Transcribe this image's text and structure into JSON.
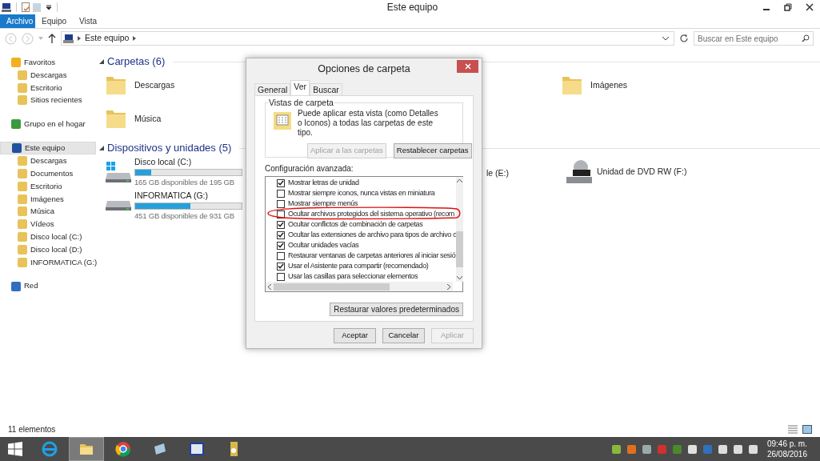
{
  "window": {
    "title": "Este equipo"
  },
  "ribbon_tabs": [
    {
      "label": "Archivo",
      "selected": true
    },
    {
      "label": "Equipo",
      "selected": false
    },
    {
      "label": "Vista",
      "selected": false
    }
  ],
  "address": {
    "path": "Este equipo",
    "search_placeholder": "Buscar en Este equipo"
  },
  "sidebar": [
    {
      "label": "Favoritos",
      "selected": false,
      "children": [
        {
          "label": "Descargas",
          "selected": false
        },
        {
          "label": "Escritorio",
          "selected": false
        },
        {
          "label": "Sitios recientes",
          "selected": false
        }
      ]
    },
    {
      "label": "Grupo en el hogar",
      "selected": false
    },
    {
      "label": "Este equipo",
      "selected": true,
      "children": [
        {
          "label": "Descargas",
          "selected": false
        },
        {
          "label": "Documentos",
          "selected": false
        },
        {
          "label": "Escritorio",
          "selected": false
        },
        {
          "label": "Imágenes",
          "selected": false
        },
        {
          "label": "Música",
          "selected": false
        },
        {
          "label": "Vídeos",
          "selected": false
        },
        {
          "label": "Disco local (C:)",
          "selected": false
        },
        {
          "label": "Disco local (D:)",
          "selected": false
        },
        {
          "label": "INFORMATICA (G:)",
          "selected": false
        }
      ]
    },
    {
      "label": "Red",
      "selected": false
    }
  ],
  "sections": [
    {
      "title": "Carpetas (6)",
      "expanded": true,
      "rows": [
        [
          {
            "kind": "folder",
            "name": "Descargas"
          },
          {
            "kind": "folder",
            "name": "Imágenes"
          }
        ],
        [
          {
            "kind": "folder",
            "name": "Música"
          }
        ]
      ]
    },
    {
      "title": "Dispositivos y unidades (5)",
      "expanded": true,
      "rows": [
        [
          {
            "kind": "drive",
            "name": "Disco local (C:)",
            "level": 0.15,
            "free": "165 GB disponibles de 195 GB"
          },
          {
            "kind": "partial",
            "name": "le (E:)"
          },
          {
            "kind": "dvd",
            "name": "Unidad de DVD RW (F:)"
          }
        ],
        [
          {
            "kind": "drive",
            "name": "INFORMATICA (G:)",
            "level": 0.52,
            "free": "451 GB disponibles de 931 GB"
          }
        ]
      ]
    }
  ],
  "status_bar": "11 elementos",
  "dialog": {
    "title": "Opciones de carpeta",
    "tabs": [
      {
        "label": "General",
        "selected": false
      },
      {
        "label": "Ver",
        "selected": true
      },
      {
        "label": "Buscar",
        "selected": false
      }
    ],
    "group_title": "Vistas de carpeta",
    "description": "Puede aplicar esta vista (como Detalles o Iconos) a todas las carpetas de este tipo.",
    "view_buttons": [
      {
        "label": "Aplicar a las carpetas",
        "disabled": true
      },
      {
        "label": "Restablecer carpetas",
        "disabled": false
      }
    ],
    "advanced_label": "Configuración avanzada:",
    "options": [
      {
        "label": "Mostrar letras de unidad",
        "checked": true
      },
      {
        "label": "Mostrar siempre iconos, nunca vistas en miniatura",
        "checked": false
      },
      {
        "label": "Mostrar siempre menús",
        "checked": false
      },
      {
        "label": "Ocultar archivos protegidos del sistema operativo (recom",
        "checked": false
      },
      {
        "label": "Ocultar conflictos de combinación de carpetas",
        "checked": true
      },
      {
        "label": "Ocultar las extensiones de archivo para tipos de archivo c",
        "checked": true
      },
      {
        "label": "Ocultar unidades vacías",
        "checked": true
      },
      {
        "label": "Restaurar ventanas de carpetas anteriores al iniciar sesió",
        "checked": false
      },
      {
        "label": "Usar el Asistente para compartir (recomendado)",
        "checked": true
      },
      {
        "label": "Usar las casillas para seleccionar elementos",
        "checked": false
      }
    ],
    "restore_button": "Restaurar valores predeterminados",
    "footer_buttons": [
      {
        "label": "Aceptar",
        "disabled": false
      },
      {
        "label": "Cancelar",
        "disabled": false
      },
      {
        "label": "Aplicar",
        "disabled": true
      }
    ]
  },
  "taskbar": {
    "apps": [
      {
        "selected": false
      },
      {
        "selected": true
      },
      {
        "selected": false
      },
      {
        "selected": false
      },
      {
        "selected": false
      },
      {
        "selected": false
      }
    ],
    "time": "09:46 p. m.",
    "date": "26/08/2016"
  }
}
